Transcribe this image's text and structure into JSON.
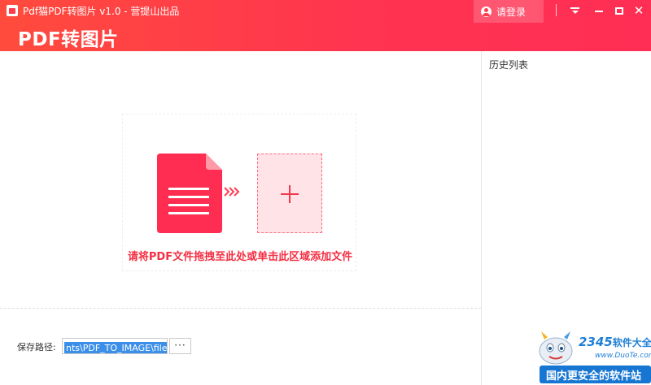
{
  "window": {
    "title": "Pdf猫PDF转图片 v1.0 - 营提山出品",
    "header_title": "PDF转图片",
    "login_label": "请登录",
    "accent_color": "#ff3450"
  },
  "titlebar_icons": [
    "user-icon",
    "menu-icon",
    "minimize-icon",
    "maximize-icon",
    "close-icon"
  ],
  "dropzone": {
    "hint": "请将PDF文件拖拽至此处或单击此区域添加文件",
    "icons": [
      "pdf-document-icon",
      "triple-chevron-right-icon",
      "plus-icon"
    ]
  },
  "save": {
    "label": "保存路径:",
    "path_value": "nts\\PDF_TO_IMAGE\\file",
    "browse_label": "···"
  },
  "side_panel": {
    "title": "历史列表"
  },
  "watermark": {
    "logo": "2345",
    "logo_cn": "软件大全",
    "url": "www.DuoTe.com",
    "slogan": "国内更安全的软件站"
  }
}
